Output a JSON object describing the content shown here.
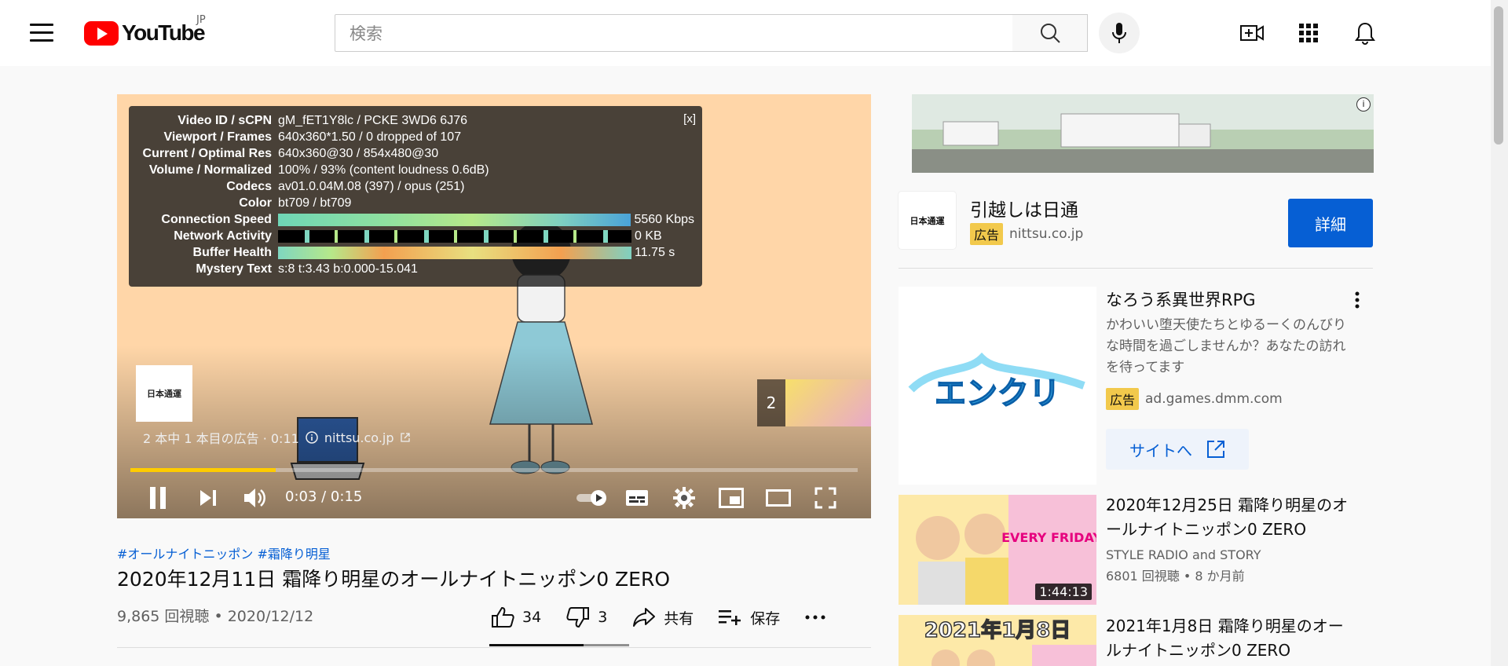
{
  "header": {
    "logo_text": "YouTube",
    "country_code": "JP",
    "search_placeholder": "検索"
  },
  "player": {
    "stats": {
      "close": "[x]",
      "rows": [
        {
          "label": "Video ID / sCPN",
          "value": "gM_fET1Y8lc / PCKE 3WD6 6J76"
        },
        {
          "label": "Viewport / Frames",
          "value": "640x360*1.50 / 0 dropped of 107"
        },
        {
          "label": "Current / Optimal Res",
          "value": "640x360@30 / 854x480@30"
        },
        {
          "label": "Volume / Normalized",
          "value": "100% / 93% (content loudness 0.6dB)"
        },
        {
          "label": "Codecs",
          "value": "av01.0.04M.08 (397) / opus (251)"
        },
        {
          "label": "Color",
          "value": "bt709 / bt709"
        },
        {
          "label": "Connection Speed",
          "value": "5560 Kbps"
        },
        {
          "label": "Network Activity",
          "value": "0 KB"
        },
        {
          "label": "Buffer Health",
          "value": "11.75 s"
        },
        {
          "label": "Mystery Text",
          "value": "s:8 t:3.43 b:0.000-15.041"
        }
      ]
    },
    "ad_logo_text": "日本通運",
    "ad_info": "2 本中 1 本目の広告 · 0:11",
    "ad_domain": "nittsu.co.jp",
    "next_ad_number": "2",
    "time": "0:03 / 0:15",
    "progress_fraction": 0.2,
    "accent_color": "#ffcc00"
  },
  "video": {
    "hashtags": "#オールナイトニッポン #霜降り明星",
    "title": "2020年12月11日 霜降り明星のオールナイトニッポン0 ZERO",
    "views": "9,865 回視聴 • 2020/12/12",
    "likes": "34",
    "dislikes": "3",
    "share_label": "共有",
    "save_label": "保存"
  },
  "sidebar": {
    "ad_card": {
      "logo_text": "日本通運",
      "title": "引越しは日通",
      "badge": "広告",
      "domain": "nittsu.co.jp",
      "button": "詳細"
    },
    "ad2": {
      "title": "なろう系異世界RPG",
      "description": "かわいい堕天使たちとゆるーくのんびりな時間を過ごしませんか？あなたの訪れを待ってます",
      "badge": "広告",
      "domain": "ad.games.dmm.com",
      "button": "サイトへ",
      "logo_text": "エンクリ"
    },
    "videos": [
      {
        "title": "2020年12月25日 霜降り明星のオールナイトニッポン0 ZERO",
        "channel": "STYLE RADIO and STORY",
        "meta": "6801 回視聴 • 8 か月前",
        "duration": "1:44:13",
        "thumb_text": "EVERY FRIDAY"
      },
      {
        "title": "2021年1月8日 霜降り明星のオールナイトニッポン0 ZERO",
        "thumb_text": "2021年1月8日"
      }
    ]
  }
}
